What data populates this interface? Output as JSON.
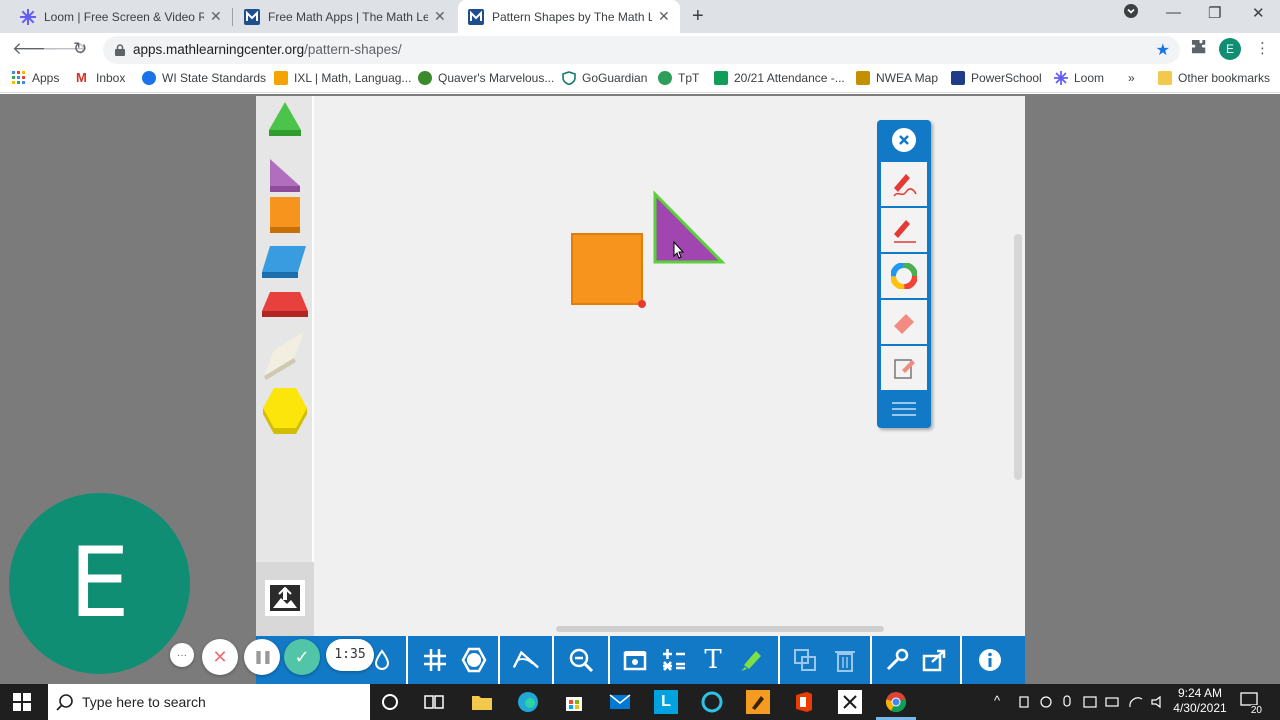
{
  "browser": {
    "tabs": [
      {
        "label": "Loom | Free Screen & Video Recording",
        "active": false
      },
      {
        "label": "Free Math Apps | The Math Learning Center",
        "active": false
      },
      {
        "label": "Pattern Shapes by The Math Learning Center",
        "active": true
      }
    ],
    "new_tab": "+",
    "window_controls": {
      "minimize": "—",
      "restore": "❐",
      "close": "✕"
    },
    "url_host": "apps.mathlearningcenter.org",
    "url_path": "/pattern-shapes/",
    "profile_initial": "E",
    "bookmarks": [
      {
        "label": "Apps",
        "color": "#4285f4"
      },
      {
        "label": "Inbox",
        "color": "#d93025"
      },
      {
        "label": "WI State Standards",
        "color": "#1a73e8"
      },
      {
        "label": "IXL | Math, Languag...",
        "color": "#f4a300"
      },
      {
        "label": "Quaver's Marvelous...",
        "color": "#3c8a2e"
      },
      {
        "label": "GoGuardian",
        "color": "#1b7a6f"
      },
      {
        "label": "TpT",
        "color": "#2e9e5b"
      },
      {
        "label": "20/21 Attendance -...",
        "color": "#0f9d58"
      },
      {
        "label": "NWEA Map",
        "color": "#c49000"
      },
      {
        "label": "PowerSchool",
        "color": "#1f3c88"
      },
      {
        "label": "Loom",
        "color": "#625df5"
      }
    ],
    "bookmarks_more": "»",
    "other_bookmarks": "Other bookmarks"
  },
  "app": {
    "shapes_palette": [
      "green-triangle",
      "purple-triangle",
      "orange-square",
      "blue-rhombus",
      "red-trapezoid",
      "tan-rhombus",
      "yellow-hexagon"
    ],
    "draw_tools": [
      "close-icon",
      "freehand-pen-icon",
      "line-pen-icon",
      "color-wheel-icon",
      "eraser-icon",
      "clear-page-icon",
      "menu-icon"
    ],
    "bottom_tools": [
      "drop-icon",
      "grid-icon",
      "shape-outline-icon",
      "protractor-icon",
      "zoom-out-icon",
      "screenshot-icon",
      "math-operations-icon",
      "text-icon",
      "highlighter-icon",
      "duplicate-icon",
      "trash-icon",
      "settings-icon",
      "share-icon",
      "info-icon"
    ],
    "text_tool_label": "T"
  },
  "loom": {
    "camera_initial": "E",
    "timer": "1:35",
    "more": "···",
    "cancel": "✕",
    "pause": "❚❚",
    "done": "✓"
  },
  "taskbar": {
    "search_placeholder": "Type here to search",
    "time": "9:24 AM",
    "date": "4/30/2021",
    "notifications": "20"
  }
}
